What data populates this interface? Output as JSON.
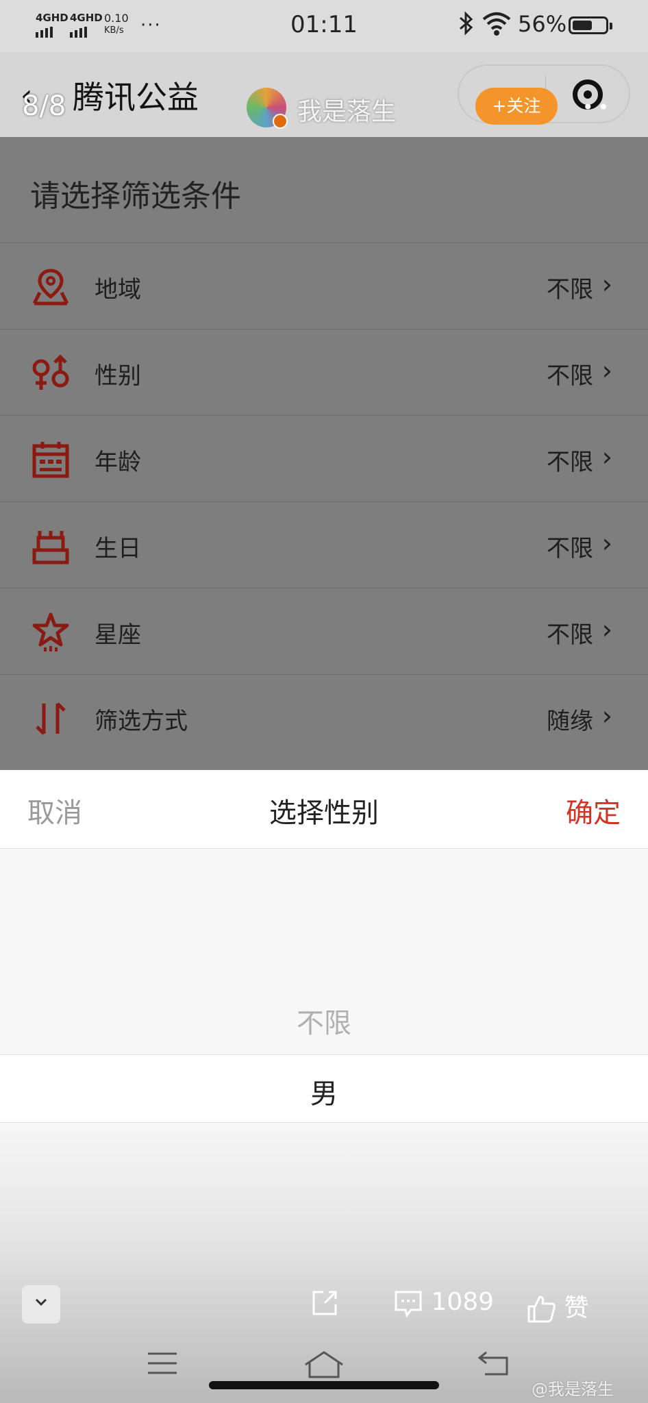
{
  "status_bar": {
    "network_1": "4GHD",
    "network_2": "4GHD",
    "speed": "0.10",
    "speed_unit": "KB/s",
    "more": "···",
    "time": "01:11",
    "battery": "56%"
  },
  "header": {
    "back_symbol": "‹",
    "page_counter": "8/8",
    "title": "腾讯公益",
    "username": "我是落生",
    "follow_label": "+关注"
  },
  "filter": {
    "title": "请选择筛选条件",
    "rows": [
      {
        "label": "地域",
        "value": "不限",
        "icon": "location-pin-icon"
      },
      {
        "label": "性别",
        "value": "不限",
        "icon": "gender-icon"
      },
      {
        "label": "年龄",
        "value": "不限",
        "icon": "calendar-icon"
      },
      {
        "label": "生日",
        "value": "不限",
        "icon": "cake-icon"
      },
      {
        "label": "星座",
        "value": "不限",
        "icon": "star-icon"
      },
      {
        "label": "筛选方式",
        "value": "随缘",
        "icon": "sort-arrows-icon"
      }
    ]
  },
  "sheet": {
    "cancel": "取消",
    "title": "选择性别",
    "confirm": "确定",
    "options": [
      "不限",
      "男"
    ],
    "selected": "男"
  },
  "actions": {
    "comment_count": "1089",
    "like_label": "赞"
  },
  "watermark": "@我是落生",
  "colors": {
    "accent_red": "#d23327",
    "follow_orange": "#f3952b",
    "icon_red": "#8b1a12"
  }
}
